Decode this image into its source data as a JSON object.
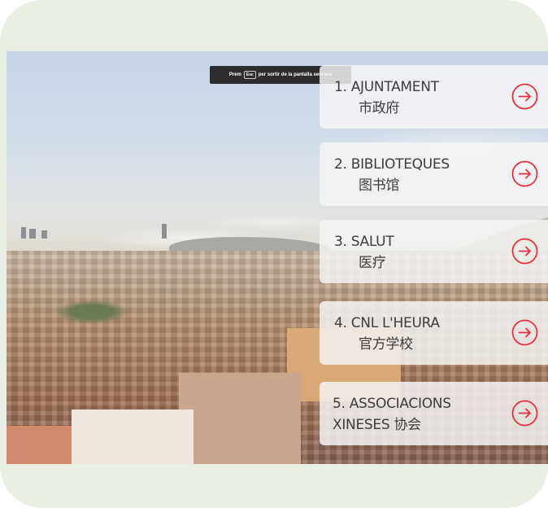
{
  "notice": {
    "prefix": "Prem",
    "key": "Esc",
    "suffix": "per sortir de la pantalla sencera"
  },
  "menu": {
    "items": [
      {
        "label": "1. AJUNTAMENT",
        "sub": "市政府"
      },
      {
        "label": "2. BIBLIOTEQUES",
        "sub": "图书馆"
      },
      {
        "label": "3. SALUT",
        "sub": "医疗"
      },
      {
        "label": "4. CNL L'HEURA",
        "sub": "官方学校"
      },
      {
        "label": "5. ASSOCIACIONS XINESES",
        "sub": "协会"
      }
    ],
    "icon": "arrow-right-circle-icon",
    "accent_color": "#e8313a"
  }
}
